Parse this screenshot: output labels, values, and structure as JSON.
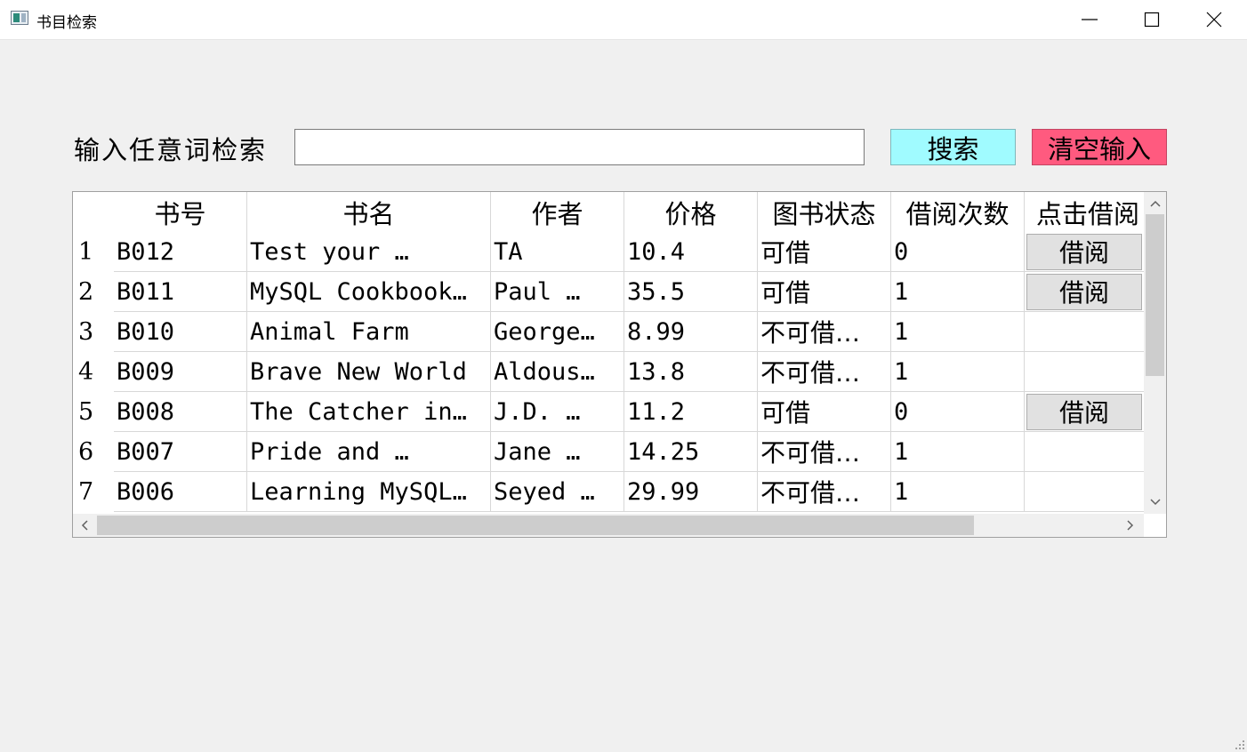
{
  "window": {
    "title": "书目检索"
  },
  "search": {
    "label": "输入任意词检索",
    "value": "",
    "placeholder": ""
  },
  "buttons": {
    "search": "搜索",
    "clear": "清空输入"
  },
  "table": {
    "headers": [
      "书号",
      "书名",
      "作者",
      "价格",
      "图书状态",
      "借阅次数",
      "点击借阅"
    ],
    "rows": [
      {
        "num": "1",
        "id": "B012",
        "title": "Test your …",
        "author": "TA",
        "price": "10.4",
        "status": "可借",
        "count": "0",
        "action": "借阅"
      },
      {
        "num": "2",
        "id": "B011",
        "title": "MySQL Cookbook…",
        "author": "Paul …",
        "price": "35.5",
        "status": "可借",
        "count": "1",
        "action": "借阅"
      },
      {
        "num": "3",
        "id": "B010",
        "title": "Animal Farm",
        "author": "George…",
        "price": "8.99",
        "status": "不可借…",
        "count": "1",
        "action": ""
      },
      {
        "num": "4",
        "id": "B009",
        "title": "Brave New World",
        "author": "Aldous…",
        "price": "13.8",
        "status": "不可借…",
        "count": "1",
        "action": ""
      },
      {
        "num": "5",
        "id": "B008",
        "title": "The Catcher in…",
        "author": "J.D. …",
        "price": "11.2",
        "status": "可借",
        "count": "0",
        "action": "借阅"
      },
      {
        "num": "6",
        "id": "B007",
        "title": "Pride and …",
        "author": "Jane …",
        "price": "14.25",
        "status": "不可借…",
        "count": "1",
        "action": ""
      },
      {
        "num": "7",
        "id": "B006",
        "title": "Learning MySQL…",
        "author": "Seyed …",
        "price": "29.99",
        "status": "不可借…",
        "count": "1",
        "action": ""
      }
    ]
  },
  "colors": {
    "search_button": "#a0fbff",
    "clear_button": "#ff5a7f",
    "background": "#f0f0f0"
  },
  "icons": {
    "app": "app-window-icon",
    "minimize": "minimize-icon",
    "maximize": "maximize-icon",
    "close": "close-icon"
  }
}
